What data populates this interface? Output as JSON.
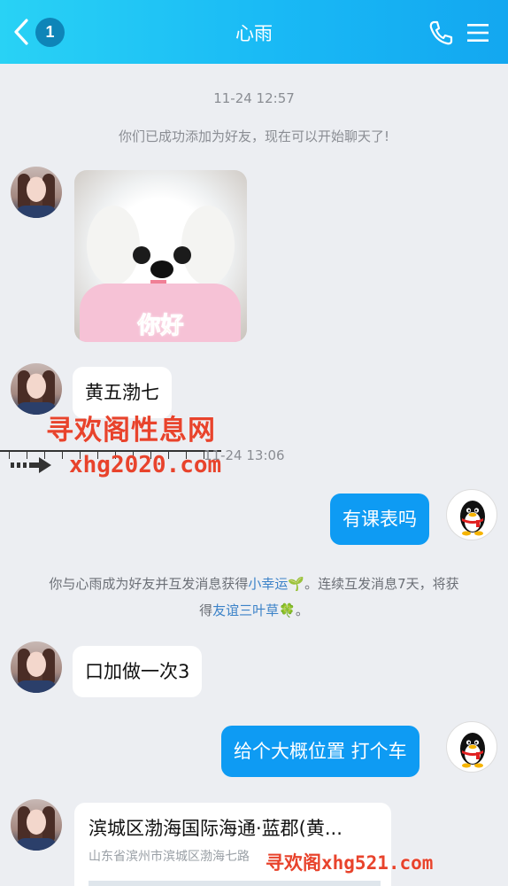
{
  "header": {
    "back_badge": "1",
    "title": "心雨",
    "icons": {
      "back": "chevron-left-icon",
      "call": "phone-icon",
      "menu": "menu-icon"
    }
  },
  "messages": {
    "time1": "11-24 12:57",
    "system_added": "你们已成功添加为好友，现在可以开始聊天了!",
    "sticker_caption": "你好",
    "msg_left_1": "黄五渤七",
    "time2": "11-24 13:06",
    "msg_right_1": "有课表吗",
    "tip_line1_a": "你与心雨成为好友并互发消息获得",
    "tip_line1_link": "小幸运",
    "tip_line1_emoji": "🌱",
    "tip_line1_b": "。连续互发消息7天，将获",
    "tip_line2_a": "得",
    "tip_line2_link": "友谊三叶草",
    "tip_line2_emoji": "🍀",
    "tip_line2_b": "。",
    "msg_left_2": "口加做一次3",
    "msg_right_2": "给个大概位置 打个车",
    "location_title": "滨城区渤海国际海通·蓝郡(黄...",
    "location_address": "山东省滨州市滨城区渤海七路"
  },
  "watermarks": {
    "line1": "寻欢阁性息网",
    "line2": "xhg2020.com",
    "line3": "寻欢阁xhg521.com"
  },
  "colors": {
    "header_gradient_start": "#29d2f5",
    "header_gradient_end": "#13a7f0",
    "bubble_outgoing": "#0e9bf3",
    "watermark": "#e8432c",
    "link": "#3b82c8"
  }
}
